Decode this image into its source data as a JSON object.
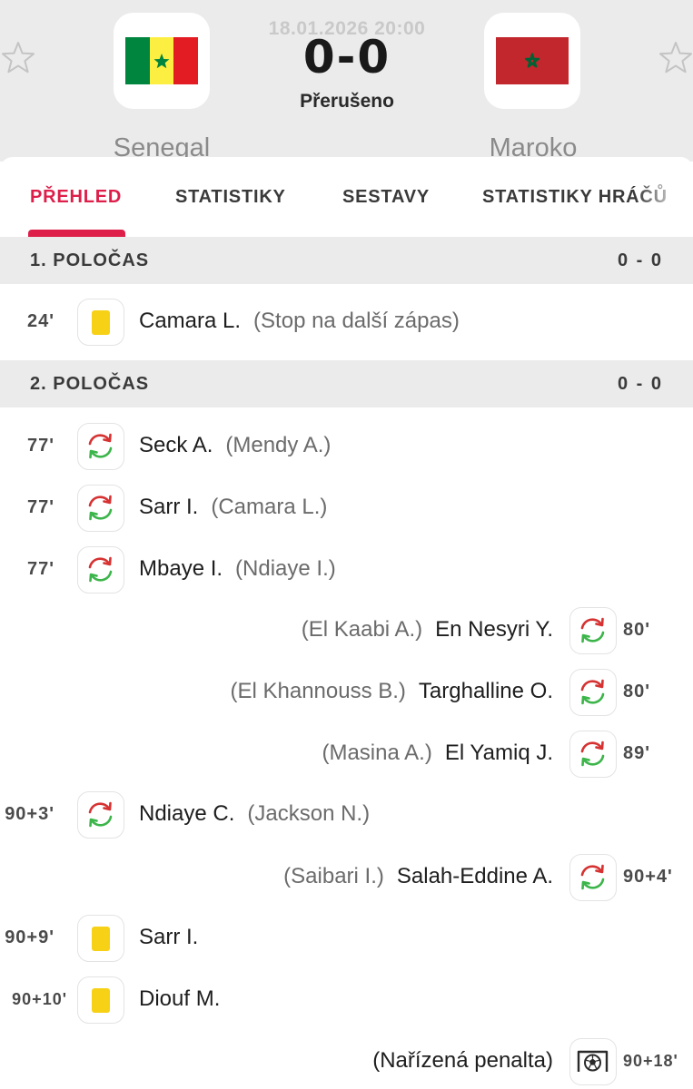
{
  "match": {
    "date": "18.01.2026 20:00",
    "score": "0-0",
    "status": "Přerušeno",
    "home_team": "Senegal",
    "away_team": "Maroko"
  },
  "icons": {
    "favorite": "star-outline-icon",
    "substitution": "substitution-arrows-icon",
    "yellow_card": "yellow-card-icon",
    "penalty": "penalty-goal-icon"
  },
  "colors": {
    "accent": "#dd1f4a",
    "yellow_card": "#f7d115",
    "sub_in": "#3cb54a",
    "sub_out": "#d63232"
  },
  "tabs": [
    {
      "label": "PŘEHLED",
      "active": true
    },
    {
      "label": "STATISTIKY",
      "active": false
    },
    {
      "label": "SESTAVY",
      "active": false
    },
    {
      "label": "STATISTIKY HRÁČŮ",
      "active": false
    }
  ],
  "sections": [
    {
      "title": "1. POLOČAS",
      "score": "0 - 0",
      "events": [
        {
          "side": "home",
          "time": "24'",
          "type": "yellow_card",
          "player": "Camara L.",
          "detail": "(Stop na další zápas)"
        }
      ]
    },
    {
      "title": "2. POLOČAS",
      "score": "0 - 0",
      "events": [
        {
          "side": "home",
          "time": "77'",
          "type": "substitution",
          "player": "Seck A.",
          "detail": "(Mendy A.)"
        },
        {
          "side": "home",
          "time": "77'",
          "type": "substitution",
          "player": "Sarr I.",
          "detail": "(Camara L.)"
        },
        {
          "side": "home",
          "time": "77'",
          "type": "substitution",
          "player": "Mbaye I.",
          "detail": "(Ndiaye I.)"
        },
        {
          "side": "away",
          "time": "80'",
          "type": "substitution",
          "player": "En Nesyri Y.",
          "detail": "(El Kaabi A.)"
        },
        {
          "side": "away",
          "time": "80'",
          "type": "substitution",
          "player": "Targhalline O.",
          "detail": "(El Khannouss B.)"
        },
        {
          "side": "away",
          "time": "89'",
          "type": "substitution",
          "player": "El Yamiq J.",
          "detail": "(Masina A.)"
        },
        {
          "side": "home",
          "time": "90+3'",
          "type": "substitution",
          "player": "Ndiaye C.",
          "detail": "(Jackson N.)"
        },
        {
          "side": "away",
          "time": "90+4'",
          "type": "substitution",
          "player": "Salah-Eddine A.",
          "detail": "(Saibari I.)"
        },
        {
          "side": "home",
          "time": "90+9'",
          "type": "yellow_card",
          "player": "Sarr I.",
          "detail": ""
        },
        {
          "side": "home",
          "time": "90+10'",
          "type": "yellow_card",
          "player": "Diouf M.",
          "detail": ""
        },
        {
          "side": "away",
          "time": "90+18'",
          "type": "penalty",
          "player": "",
          "detail": "(Nařízená penalta)"
        }
      ]
    }
  ]
}
